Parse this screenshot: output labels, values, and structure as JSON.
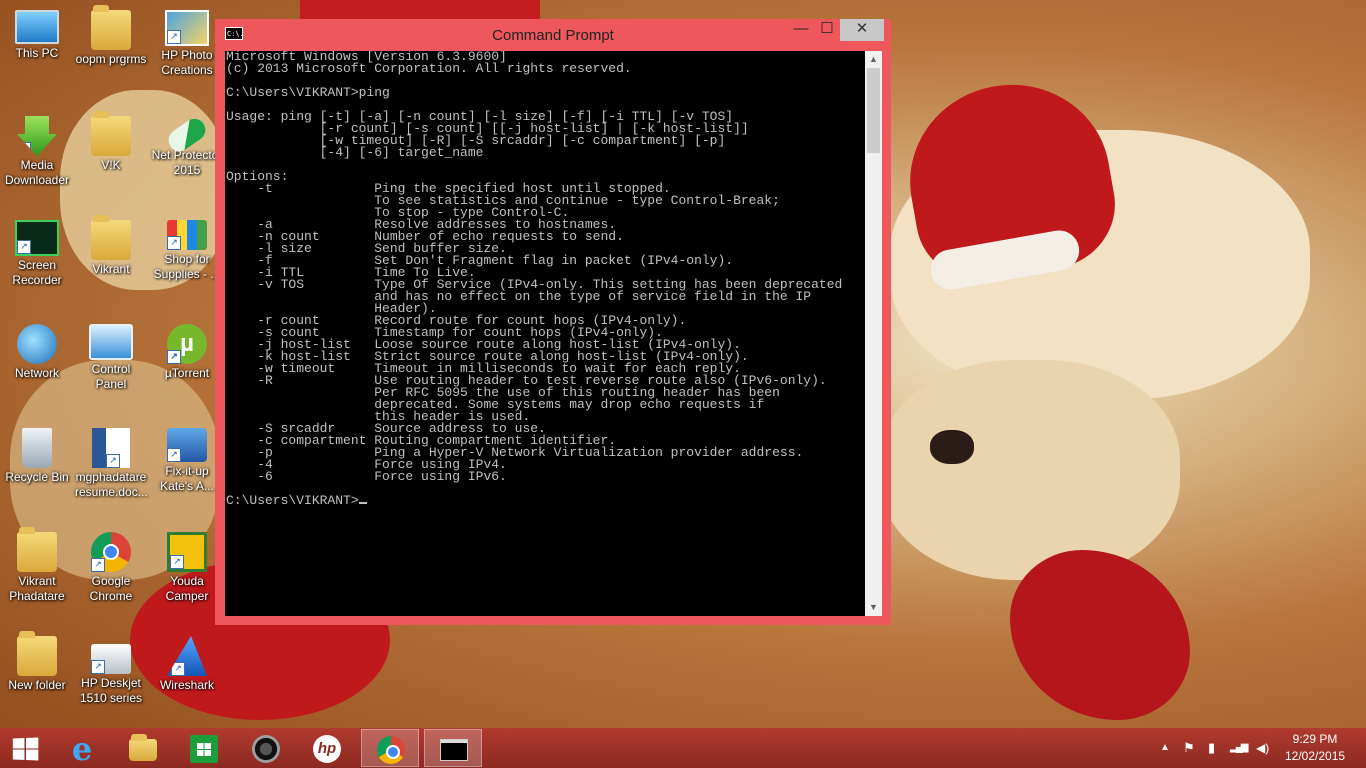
{
  "desktop": {
    "icons": [
      {
        "label": "This PC"
      },
      {
        "label": "oopm prgrms"
      },
      {
        "label": "HP Photo Creations"
      },
      {
        "label": "Media Downloader"
      },
      {
        "label": "V!K"
      },
      {
        "label": "Net Protector 2015"
      },
      {
        "label": "Screen Recorder"
      },
      {
        "label": "Vikrant"
      },
      {
        "label": "Shop for Supplies - ..."
      },
      {
        "label": "Network"
      },
      {
        "label": "Control Panel"
      },
      {
        "label": "µTorrent"
      },
      {
        "label": "Recycle Bin"
      },
      {
        "label": "mgphadatare resume.doc..."
      },
      {
        "label": "Fix-it-up Kate's A..."
      },
      {
        "label": "Vikrant Phadatare"
      },
      {
        "label": "Google Chrome"
      },
      {
        "label": "Youda Camper"
      },
      {
        "label": "New folder"
      },
      {
        "label": "HP Deskjet 1510 series"
      },
      {
        "label": "Wireshark"
      }
    ]
  },
  "window": {
    "title": "Command Prompt",
    "icon_text": "C:\\.",
    "minimize": "—",
    "maximize": "☐",
    "close": "✕",
    "console_text": "Microsoft Windows [Version 6.3.9600]\n(c) 2013 Microsoft Corporation. All rights reserved.\n\nC:\\Users\\VIKRANT>ping\n\nUsage: ping [-t] [-a] [-n count] [-l size] [-f] [-i TTL] [-v TOS]\n            [-r count] [-s count] [[-j host-list] | [-k host-list]]\n            [-w timeout] [-R] [-S srcaddr] [-c compartment] [-p]\n            [-4] [-6] target_name\n\nOptions:\n    -t             Ping the specified host until stopped.\n                   To see statistics and continue - type Control-Break;\n                   To stop - type Control-C.\n    -a             Resolve addresses to hostnames.\n    -n count       Number of echo requests to send.\n    -l size        Send buffer size.\n    -f             Set Don't Fragment flag in packet (IPv4-only).\n    -i TTL         Time To Live.\n    -v TOS         Type Of Service (IPv4-only. This setting has been deprecated\n                   and has no effect on the type of service field in the IP\n                   Header).\n    -r count       Record route for count hops (IPv4-only).\n    -s count       Timestamp for count hops (IPv4-only).\n    -j host-list   Loose source route along host-list (IPv4-only).\n    -k host-list   Strict source route along host-list (IPv4-only).\n    -w timeout     Timeout in milliseconds to wait for each reply.\n    -R             Use routing header to test reverse route also (IPv6-only).\n                   Per RFC 5095 the use of this routing header has been\n                   deprecated. Some systems may drop echo requests if\n                   this header is used.\n    -S srcaddr     Source address to use.\n    -c compartment Routing compartment identifier.\n    -p             Ping a Hyper-V Network Virtualization provider address.\n    -4             Force using IPv4.\n    -6             Force using IPv6.\n\nC:\\Users\\VIKRANT>",
    "scroll_up": "▲",
    "scroll_down": "▼"
  },
  "taskbar": {
    "items": [
      {
        "icon": "start-icon"
      },
      {
        "icon": "internet-explorer-icon"
      },
      {
        "icon": "file-explorer-icon"
      },
      {
        "icon": "store-icon"
      },
      {
        "icon": "camera-icon"
      },
      {
        "icon": "hp-icon"
      },
      {
        "icon": "chrome-icon"
      },
      {
        "icon": "cmd-icon"
      }
    ],
    "tray": {
      "show_hidden": "▲",
      "flag": "⚑",
      "battery": "▮",
      "signal": "▂▄▆",
      "volume": "◀)"
    },
    "clock": {
      "time": "9:29 PM",
      "date": "12/02/2015"
    }
  },
  "colors": {
    "window_frame": "#ee585c",
    "console_bg": "#000000",
    "console_fg": "#c0c0c0",
    "taskbar": "#a5352a"
  }
}
